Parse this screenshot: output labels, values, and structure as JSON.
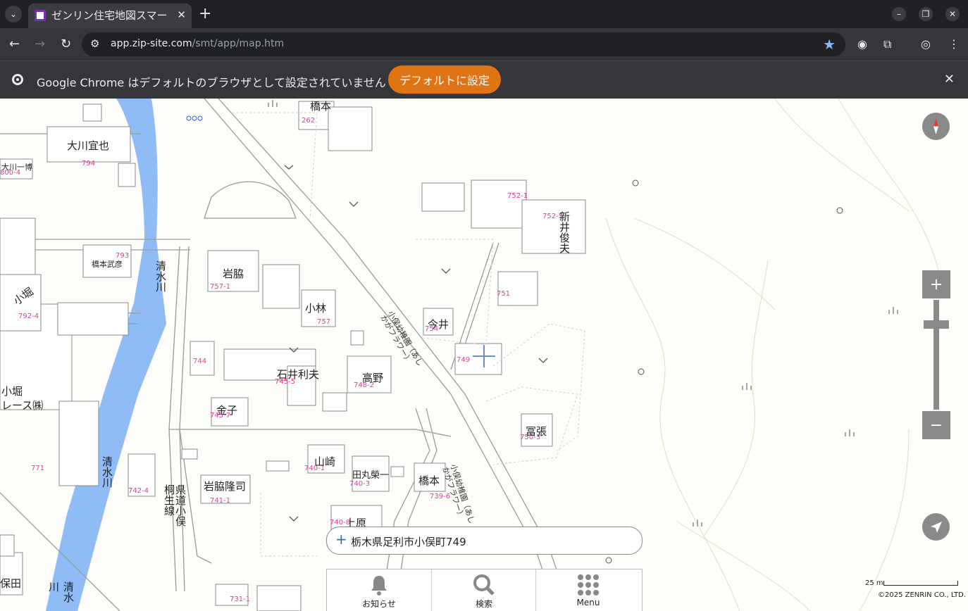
{
  "browser": {
    "tab_title": "ゼンリン住宅地図スマー",
    "url_host": "app.zip-site.com",
    "url_path": "/smt/app/map.htm",
    "infobar_message": "Google Chrome はデフォルトのブラウザとして設定されていません",
    "infobar_button": "デフォルトに設定"
  },
  "map": {
    "address": "栃木県足利市小俣町749",
    "labels": {
      "hashimoto_top": "橋本",
      "okawa": "大川宜也",
      "okawa_ichi": "大川一博",
      "hashimoto_takehiko": "橋本武彦",
      "kobori": "小堀",
      "kobori_race": "小堀\nレース㈱",
      "iwawaki": "岩脇",
      "kobayashi": "小林",
      "imai": "今井",
      "ishii": "石井利夫",
      "takano": "高野",
      "kaneko": "金子",
      "yamazaki": "山崎",
      "tamaru": "田丸榮一",
      "iwawaki_ryuji": "岩脇隆司",
      "hashimoto_bottom": "橋本",
      "uehara": "上原",
      "tomihari": "冨張",
      "arai": "新井俊夫",
      "hota": "保田",
      "river1": "清水川",
      "river2": "清水川",
      "river3": "清水川",
      "road_kiryu": "県道小俣\n桐生線",
      "road_nominee1": "小俣幼稚園（あし\nかがフラワー）",
      "road_nominee2": "小俣幼稚園（あし\nかがフラワー）"
    },
    "lot_numbers": {
      "n262": "262",
      "n794": "794",
      "n800": "800-4",
      "n793": "793",
      "n752_1": "752-1",
      "n752_5": "752-5",
      "n751": "751",
      "n757_1": "757-1",
      "n757": "757",
      "n754": "754",
      "n749": "749",
      "n744": "744",
      "n745_5": "745-5",
      "n748_2": "748-2",
      "n745_7": "745-7",
      "n750_3": "750-3",
      "n792": "792-4",
      "n771": "771",
      "n740_1": "740-1",
      "n740_3": "740-3",
      "n742_4": "742-4",
      "n741_1": "741-1",
      "n739_6": "739-6",
      "n740_x": "740-8",
      "n731": "731-1"
    },
    "scale_label": "25 m",
    "copyright": "©2025 ZENRIN CO., LTD."
  },
  "nav": {
    "notice": "お知らせ",
    "search": "検索",
    "menu": "Menu"
  }
}
